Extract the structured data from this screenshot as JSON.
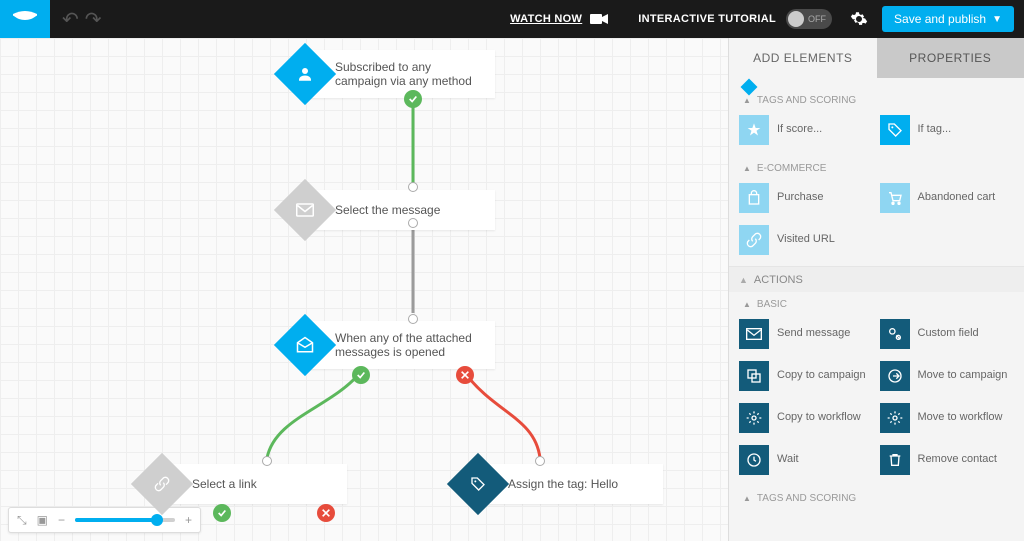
{
  "topbar": {
    "watch_now": "WATCH NOW",
    "tutorial_label": "INTERACTIVE TUTORIAL",
    "toggle_state": "OFF",
    "save_label": "Save and publish"
  },
  "tabs": {
    "add_elements": "ADD ELEMENTS",
    "properties": "PROPERTIES"
  },
  "conditions": {
    "tags_scoring_header": "TAGS AND SCORING",
    "if_score": "If score...",
    "if_tag": "If tag...",
    "ecommerce_header": "E-COMMERCE",
    "purchase": "Purchase",
    "abandoned_cart": "Abandoned cart",
    "visited_url": "Visited URL"
  },
  "actions": {
    "header": "ACTIONS",
    "basic_header": "BASIC",
    "send_message": "Send message",
    "custom_field": "Custom field",
    "copy_campaign": "Copy to campaign",
    "move_campaign": "Move to campaign",
    "copy_workflow": "Copy to workflow",
    "move_workflow": "Move to workflow",
    "wait": "Wait",
    "remove_contact": "Remove contact",
    "tags_scoring_footer": "TAGS AND SCORING"
  },
  "nodes": {
    "subscribed": "Subscribed to any campaign via any method",
    "select_message": "Select the message",
    "opened": "When any of the attached messages is opened",
    "select_link": "Select a link",
    "assign_tag": "Assign the tag: Hello"
  },
  "slider": {
    "percent": 80
  },
  "colors": {
    "accent": "#00aeef",
    "dark_action": "#135b7a",
    "light_cond": "#8fd6f2",
    "green": "#5cb85c",
    "red": "#e74c3c"
  }
}
